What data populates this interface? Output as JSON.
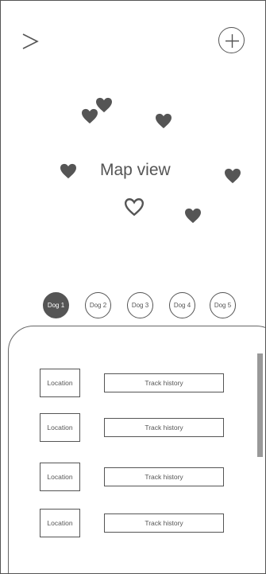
{
  "header": {
    "nav_icon": "chevron-right-icon",
    "add_icon": "plus-icon"
  },
  "map": {
    "label": "Map view",
    "marker_icon": "heart-icon",
    "selected_marker_icon": "heart-outline-icon"
  },
  "dogs": [
    {
      "label": "Dog 1",
      "active": true
    },
    {
      "label": "Dog 2",
      "active": false
    },
    {
      "label": "Dog 3",
      "active": false
    },
    {
      "label": "Dog 4",
      "active": false
    },
    {
      "label": "Dog 5",
      "active": false
    }
  ],
  "rows": [
    {
      "location_label": "Location",
      "track_label": "Track history"
    },
    {
      "location_label": "Location",
      "track_label": "Track history"
    },
    {
      "location_label": "Location",
      "track_label": "Track history"
    },
    {
      "location_label": "Location",
      "track_label": "Track history"
    }
  ],
  "colors": {
    "ink": "#555555",
    "scrollbar": "#999999",
    "background": "#ffffff"
  }
}
